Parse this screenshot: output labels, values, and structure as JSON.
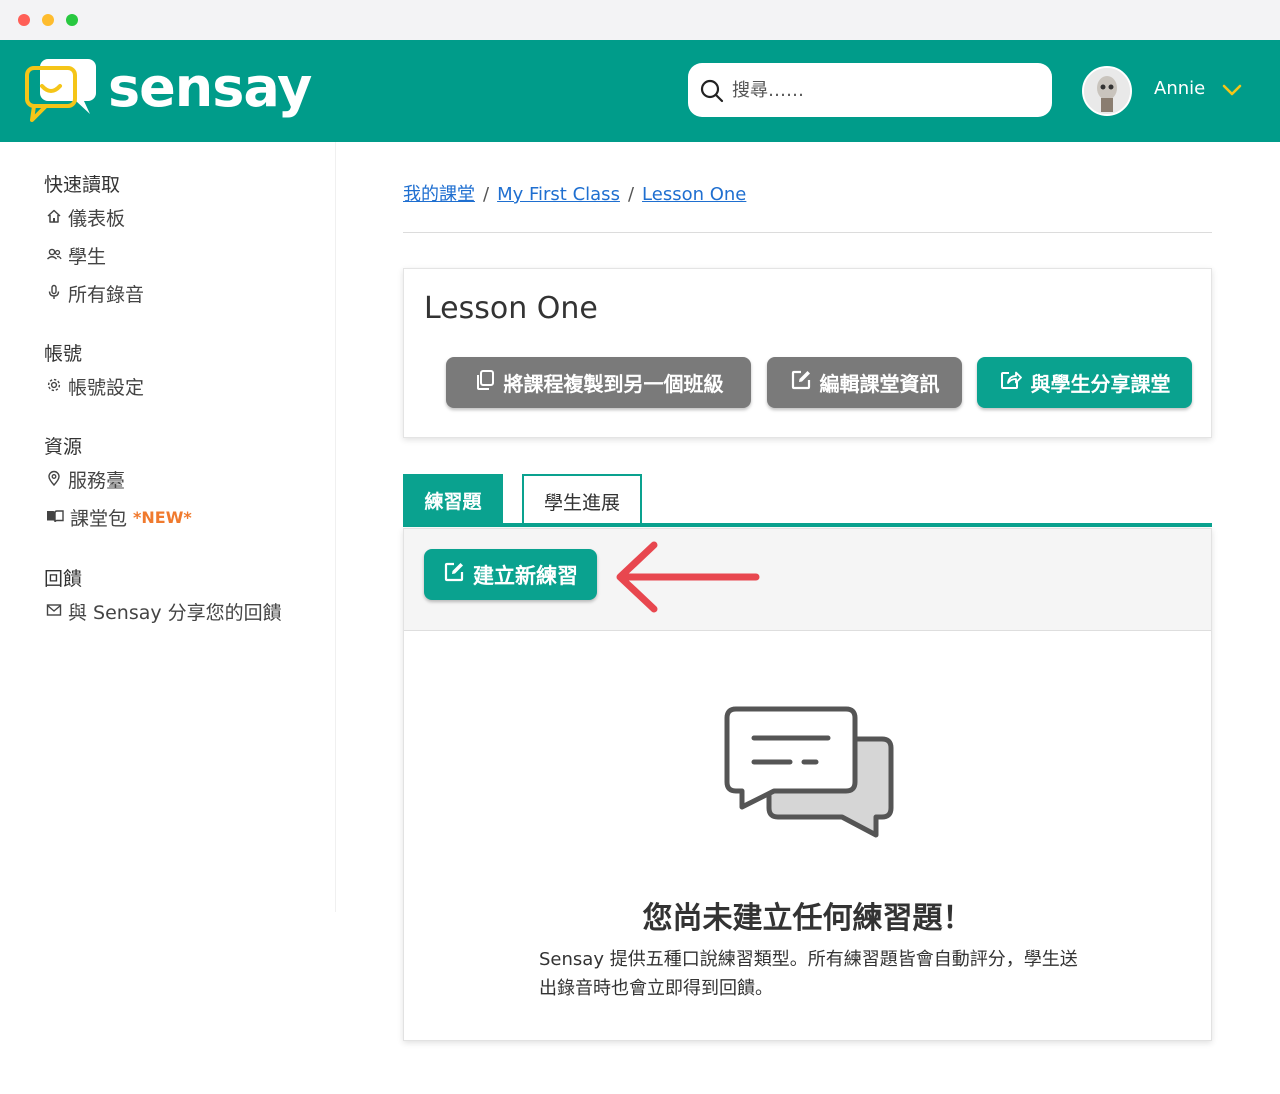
{
  "brand": {
    "name": "sensay"
  },
  "header": {
    "search_placeholder": "搜尋……",
    "user_name": "Annie"
  },
  "sidebar": {
    "sections": [
      {
        "title": "快速讀取",
        "items": [
          {
            "label": "儀表板",
            "icon": "home-icon"
          },
          {
            "label": "學生",
            "icon": "users-icon"
          },
          {
            "label": "所有錄音",
            "icon": "microphone-icon"
          }
        ]
      },
      {
        "title": "帳號",
        "items": [
          {
            "label": "帳號設定",
            "icon": "gear-icon"
          }
        ]
      },
      {
        "title": "資源",
        "items": [
          {
            "label": "服務臺",
            "icon": "location-pin-icon"
          },
          {
            "label": "課堂包",
            "icon": "book-icon",
            "badge": "*NEW*"
          }
        ]
      },
      {
        "title": "回饋",
        "items": [
          {
            "label": "與 Sensay 分享您的回饋",
            "icon": "mail-icon"
          }
        ]
      }
    ]
  },
  "breadcrumb": {
    "items": [
      "我的課堂",
      "My First Class",
      "Lesson One"
    ],
    "separator": "/"
  },
  "lesson": {
    "title": "Lesson One",
    "actions": {
      "copy": "將課程複製到另一個班級",
      "edit": "編輯課堂資訊",
      "share": "與學生分享課堂"
    }
  },
  "tabs": {
    "exercises": "練習題",
    "progress": "學生進展"
  },
  "panel": {
    "create_button": "建立新練習",
    "empty_title": "您尚未建立任何練習題！",
    "empty_description": "Sensay 提供五種口說練習類型。所有練習題皆會自動評分，學生送出錄音時也會立即得到回饋。"
  },
  "colors": {
    "brand_teal": "#009c8a",
    "button_teal": "#0aa28f",
    "button_grey": "#7a7a7a",
    "link": "#1f6fd0",
    "new_badge": "#f07a2e",
    "arrow": "#e8474f",
    "logo_yellow": "#f5c518"
  }
}
